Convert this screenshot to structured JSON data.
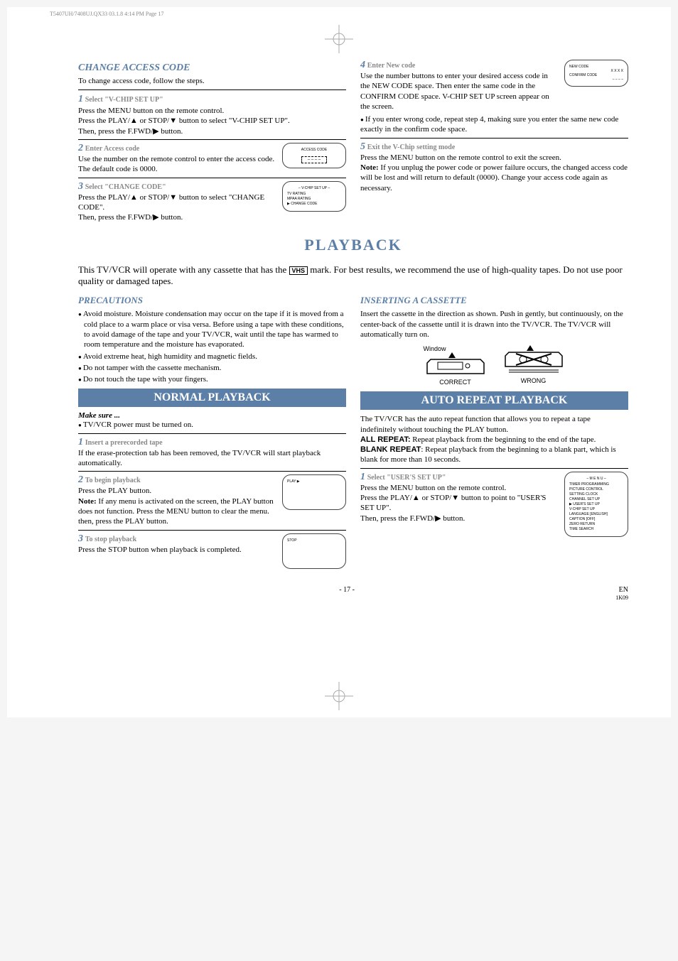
{
  "header": "T5407UH/7408UJ.QX33  03.1.8  4:14 PM  Page 17",
  "change_access": {
    "title": "CHANGE ACCESS CODE",
    "intro": "To change access code, follow the steps.",
    "steps": [
      {
        "num": "1",
        "title": "Select \"V-CHIP SET UP\"",
        "body": "Press the MENU button on the remote control.\nPress the PLAY/▲ or STOP/▼ button to select \"V-CHIP SET UP\".\nThen, press the F.FWD/▶ button."
      },
      {
        "num": "2",
        "title": "Enter Access code",
        "body": "Use the number on the remote control to enter the access code.\nThe default code is 0000."
      },
      {
        "num": "3",
        "title": "Select \"CHANGE CODE\"",
        "body": "Press the PLAY/▲ or STOP/▼ button to select \"CHANGE CODE\".\nThen, press the F.FWD/▶ button."
      },
      {
        "num": "4",
        "title": "Enter New code",
        "body": "Use the number buttons to enter your desired access code in the NEW CODE space. Then enter the same code in the CONFIRM CODE space. V-CHIP SET UP screen appear on the screen."
      },
      {
        "num": "5",
        "title": "Exit the V-Chip setting mode",
        "body": "Press the MENU button on the remote control to exit the screen."
      }
    ],
    "step4_bullet": "If you enter wrong code, repeat step 4, making sure you enter the same new code exactly in the confirm code space.",
    "step5_note": "If you unplug the power code or power failure occurs, the changed access code will be lost and will return to default (0000). Change your access code again as necessary.",
    "osd2": {
      "title": "ACCESS CODE",
      "box": "– – – –"
    },
    "osd3": {
      "title": "– V-CHIP SET UP –",
      "lines": [
        "TV RATING",
        "MPAA RATING",
        "CHANGE CODE"
      ]
    },
    "osd4": {
      "l1": "NEW CODE",
      "v1": "X X X X",
      "l2": "CONFIRM CODE",
      "v2": "– – – –"
    }
  },
  "playback": {
    "banner": "PLAYBACK",
    "intro_a": "This TV/VCR will operate with any cassette that has the ",
    "vhs": "VHS",
    "intro_b": " mark. For best results, we recommend the use of high-quality tapes. Do not use poor quality or damaged tapes."
  },
  "precautions": {
    "title": "PRECAUTIONS",
    "items": [
      "Avoid moisture. Moisture condensation may occur on the tape if it is moved from a cold place to a warm place or visa versa. Before using a tape with these conditions, to avoid damage of the tape and your TV/VCR, wait until the tape has warmed to room temperature and the moisture has evaporated.",
      "Avoid extreme heat, high humidity and magnetic fields.",
      "Do not tamper with the cassette mechanism.",
      "Do not touch the tape with your fingers."
    ]
  },
  "inserting": {
    "title": "INSERTING A CASSETTE",
    "body": "Insert the cassette in the direction as shown. Push in gently, but continuously, on the center-back of the cassette until it is drawn into the TV/VCR. The TV/VCR will automatically turn on.",
    "window": "Window",
    "correct": "CORRECT",
    "wrong": "WRONG"
  },
  "normal": {
    "banner": "NORMAL PLAYBACK",
    "make_sure": "Make sure ...",
    "power": "TV/VCR power must be turned on.",
    "steps": [
      {
        "num": "1",
        "title": "Insert a prerecorded tape",
        "body": "If the erase-protection tab has been removed, the TV/VCR will start playback automatically."
      },
      {
        "num": "2",
        "title": "To begin playback",
        "body": "Press the PLAY button.",
        "note": "If any menu is activated on the screen, the PLAY button does not function. Press the MENU button to clear the menu. then, press the PLAY button."
      },
      {
        "num": "3",
        "title": "To stop playback",
        "body": "Press the STOP button when playback is completed."
      }
    ],
    "osd_play": "PLAY ▶",
    "osd_stop": "STOP"
  },
  "auto": {
    "banner": "AUTO REPEAT PLAYBACK",
    "intro": "The TV/VCR has the auto repeat function that allows you to repeat a tape indefinitely without touching the PLAY button.",
    "all_label": "ALL REPEAT:",
    "all_body": " Repeat playback from the beginning to the end of the tape.",
    "blank_label": "BLANK REPEAT",
    "blank_body": ": Repeat playback from the beginning to a blank part, which is blank for more than 10 seconds.",
    "step": {
      "num": "1",
      "title": "Select \"USER'S SET UP\"",
      "body": "Press the MENU button on the remote control.\nPress the PLAY/▲ or STOP/▼ button to point to \"USER'S SET UP\".\nThen, press the F.FWD/▶ button."
    },
    "osd": {
      "title": "– M E N U –",
      "lines": [
        "TIMER PROGRAMMING",
        "PICTURE CONTROL",
        "SETTING CLOCK",
        "CHANNEL SET UP",
        "USER'S SET UP",
        "V-CHIP SET UP",
        "LANGUAGE  [ENGLISH]",
        "CAPTION  [OFF]",
        "ZERO RETURN",
        "TIME SEARCH"
      ]
    }
  },
  "footer": {
    "page": "- 17 -",
    "en": "EN",
    "code": "1K09"
  }
}
